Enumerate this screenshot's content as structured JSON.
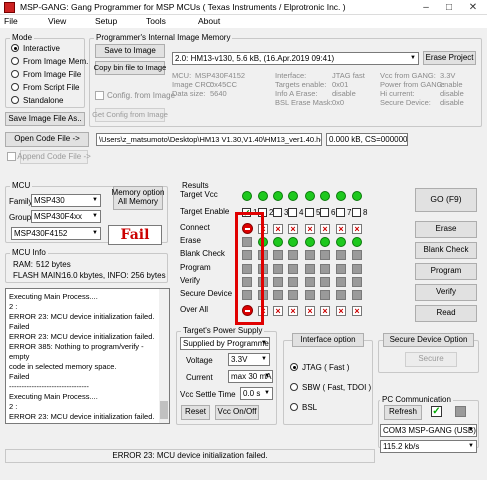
{
  "title": "MSP-GANG:  Gang Programmer for MSP MCUs ( Texas Instruments / Elprotronic Inc. )",
  "menu": [
    "File",
    "View",
    "Setup",
    "Tools",
    "About"
  ],
  "mode": {
    "label": "Mode",
    "options": [
      "Interactive",
      "From Image Mem.",
      "From Image File",
      "From Script File",
      "Standalone"
    ],
    "selected": 0,
    "save_btn": "Save Image File As.."
  },
  "pim": {
    "label": "Programmer's Internal Image Memory",
    "save_btn": "Save to Image",
    "copy_btn": "Copy bin file to Image",
    "config_cb": "Config. from Image",
    "get_btn": "Get Config from Image",
    "selection": "2.0: HM13-v130,   5.6 kB,  (16.Apr.2019  09:41)",
    "erase_btn": "Erase Project",
    "info": [
      [
        "MCU:",
        "MSP430F4152"
      ],
      [
        "Image CRC:",
        "0x45CC"
      ],
      [
        "Data size:",
        "5640"
      ],
      [
        "Interface:",
        "JTAG fast"
      ],
      [
        "Targets enable:",
        "0x01"
      ],
      [
        "Info A Erase:",
        "disable"
      ],
      [
        "BSL Erase Mask:",
        "0x0"
      ],
      [
        "Vcc from GANG:",
        "3.3V"
      ],
      [
        "Power from GANG:",
        "enable"
      ],
      [
        "Hi current:",
        "disable"
      ],
      [
        "Secure Device:",
        "disable"
      ]
    ]
  },
  "code": {
    "open_btn": "Open Code File ->",
    "append_btn": "Append Code File ->",
    "path": "\\Users\\z_matsumoto\\Desktop\\HM13 V1.30,V1.40\\HM13_ver1.40.hex",
    "size": "0.000 kB, CS=00000000"
  },
  "mcu": {
    "label": "MCU",
    "family_label": "Family",
    "family": "MSP430",
    "group_label": "Group",
    "group": "MSP430F4xx",
    "device": "MSP430F4152",
    "memopt_label": "Memory option",
    "memopt_value": "All Memory",
    "fail": "Fail"
  },
  "mcuinfo": {
    "label": "MCU Info",
    "ram_label": "RAM:",
    "ram": "512 bytes",
    "flash_label": "FLASH MAIN:",
    "flash": "16.0 kbytes,  INFO: 256 bytes"
  },
  "log": [
    "Executing Main Process....",
    "2 :",
    "ERROR 23: MCU device initialization failed.",
    "Failed",
    "ERROR 23: MCU device initialization failed.",
    "ERROR 385: Nothing to program/verify - empty",
    "code in selected memory space.",
    "Failed",
    "Executing Main Process....",
    "2 :",
    "ERROR 23: MCU device initialization failed.",
    "ERROR 23: MCU device initialization failed."
  ],
  "results": {
    "label": "Results",
    "rows": [
      "Target Vcc",
      "Target Enable",
      "Connect",
      "Erase",
      "Blank Check",
      "Program",
      "Verify",
      "Secure Device",
      "Over All"
    ],
    "targets": [
      "1",
      "2",
      "3",
      "4",
      "5",
      "6",
      "7",
      "8"
    ]
  },
  "buttons": {
    "go": "GO   (F9)",
    "erase": "Erase",
    "blank": "Blank Check",
    "program": "Program",
    "verify": "Verify",
    "read": "Read"
  },
  "power": {
    "label": "Target's Power Supply",
    "supply": "Supplied by Programmer",
    "voltage_label": "Voltage",
    "voltage": "3.3V",
    "current_label": "Current",
    "current": "max 30 mA",
    "settle_label": "Vcc Settle Time",
    "settle": "0.0 s",
    "reset_btn": "Reset",
    "vcc_btn": "Vcc On/Off"
  },
  "iface": {
    "btn": "Interface option",
    "options": [
      "JTAG ( Fast )",
      "SBW ( Fast, TDOI )",
      "BSL"
    ],
    "selected": 0
  },
  "secure": {
    "btn": "Secure Device Option",
    "secure_btn": "Secure"
  },
  "pccomm": {
    "label": "PC Communication",
    "refresh": "Refresh",
    "port": "COM3   MSP-GANG (USB)",
    "baud": "115.2 kb/s"
  },
  "status": "ERROR 23: MCU device initialization failed.",
  "colors": {
    "fail": "#cc0000",
    "led": "#1ec81e",
    "highlight": "#e00000"
  }
}
